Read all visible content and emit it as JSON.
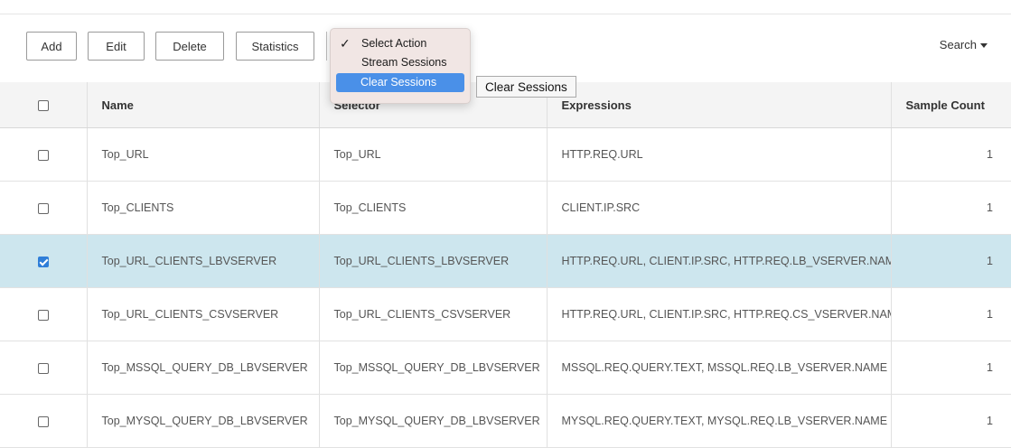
{
  "toolbar": {
    "buttons": {
      "add": "Add",
      "edit": "Edit",
      "delete": "Delete",
      "statistics": "Statistics"
    },
    "search_label": "Search"
  },
  "action_menu": {
    "items": [
      {
        "label": "Select Action",
        "checked": true
      },
      {
        "label": "Stream Sessions",
        "checked": false
      },
      {
        "label": "Clear Sessions",
        "highlighted": true
      }
    ],
    "tooltip": "Clear Sessions"
  },
  "table": {
    "columns": [
      "Name",
      "Selector",
      "Expressions",
      "Sample Count"
    ],
    "rows": [
      {
        "checked": false,
        "name": "Top_URL",
        "selector": "Top_URL",
        "expressions": "HTTP.REQ.URL",
        "sample_count": "1"
      },
      {
        "checked": false,
        "name": "Top_CLIENTS",
        "selector": "Top_CLIENTS",
        "expressions": "CLIENT.IP.SRC",
        "sample_count": "1"
      },
      {
        "checked": true,
        "name": "Top_URL_CLIENTS_LBVSERVER",
        "selector": "Top_URL_CLIENTS_LBVSERVER",
        "expressions": "HTTP.REQ.URL, CLIENT.IP.SRC, HTTP.REQ.LB_VSERVER.NAME",
        "sample_count": "1"
      },
      {
        "checked": false,
        "name": "Top_URL_CLIENTS_CSVSERVER",
        "selector": "Top_URL_CLIENTS_CSVSERVER",
        "expressions": "HTTP.REQ.URL, CLIENT.IP.SRC, HTTP.REQ.CS_VSERVER.NAME",
        "sample_count": "1"
      },
      {
        "checked": false,
        "name": "Top_MSSQL_QUERY_DB_LBVSERVER",
        "selector": "Top_MSSQL_QUERY_DB_LBVSERVER",
        "expressions": "MSSQL.REQ.QUERY.TEXT, MSSQL.REQ.LB_VSERVER.NAME",
        "sample_count": "1"
      },
      {
        "checked": false,
        "name": "Top_MYSQL_QUERY_DB_LBVSERVER",
        "selector": "Top_MYSQL_QUERY_DB_LBVSERVER",
        "expressions": "MYSQL.REQ.QUERY.TEXT, MYSQL.REQ.LB_VSERVER.NAME",
        "sample_count": "1"
      }
    ]
  },
  "colors": {
    "selected_row": "#cde6ee",
    "menu_highlight": "#4a90e8",
    "header_bg": "#f4f4f4"
  }
}
